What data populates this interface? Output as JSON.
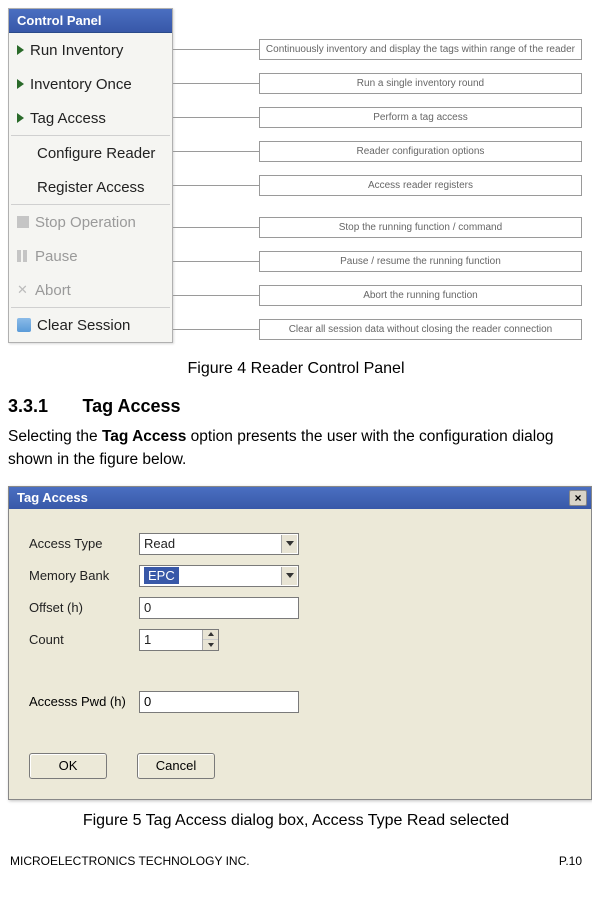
{
  "figure1": {
    "panel_title": "Control Panel",
    "items": [
      {
        "label": "Run Inventory",
        "icon": "tri",
        "disabled": false,
        "desc": "Continuously inventory and display the tags within range of the reader"
      },
      {
        "label": "Inventory Once",
        "icon": "tri",
        "disabled": false,
        "desc": "Run a single inventory round"
      },
      {
        "label": "Tag Access",
        "icon": "tri",
        "disabled": false,
        "desc": "Perform a tag access"
      },
      {
        "label": "Configure Reader",
        "icon": "none",
        "disabled": false,
        "desc": "Reader configuration options",
        "sep_before": true
      },
      {
        "label": "Register Access",
        "icon": "none",
        "disabled": false,
        "desc": "Access reader registers"
      },
      {
        "label": "Stop Operation",
        "icon": "sq",
        "disabled": true,
        "desc": "Stop the running function / command",
        "sep_before": true
      },
      {
        "label": "Pause",
        "icon": "pause",
        "disabled": true,
        "desc": "Pause / resume the running function"
      },
      {
        "label": "Abort",
        "icon": "x",
        "disabled": true,
        "desc": "Abort the running function"
      },
      {
        "label": "Clear Session",
        "icon": "clear",
        "disabled": false,
        "desc": "Clear all session data without closing the reader connection",
        "sep_before": true
      }
    ],
    "caption": "Figure 4 Reader Control Panel"
  },
  "section": {
    "number": "3.3.1",
    "title": "Tag Access",
    "body_pre": "Selecting the ",
    "body_bold": "Tag Access",
    "body_post": " option presents the user with the configuration dialog shown in the figure below."
  },
  "dialog": {
    "title": "Tag Access",
    "close": "×",
    "labels": {
      "access_type": "Access Type",
      "memory_bank": "Memory Bank",
      "offset": "Offset (h)",
      "count": "Count",
      "access_pwd": "Accesss Pwd (h)"
    },
    "values": {
      "access_type": "Read",
      "memory_bank": "EPC",
      "offset": "0",
      "count": "1",
      "access_pwd": "0"
    },
    "buttons": {
      "ok": "OK",
      "cancel": "Cancel"
    },
    "caption": "Figure 5 Tag Access dialog box, Access Type Read selected"
  },
  "footer": {
    "left": "MICROELECTRONICS TECHNOLOGY INC.",
    "right": "P.10"
  }
}
